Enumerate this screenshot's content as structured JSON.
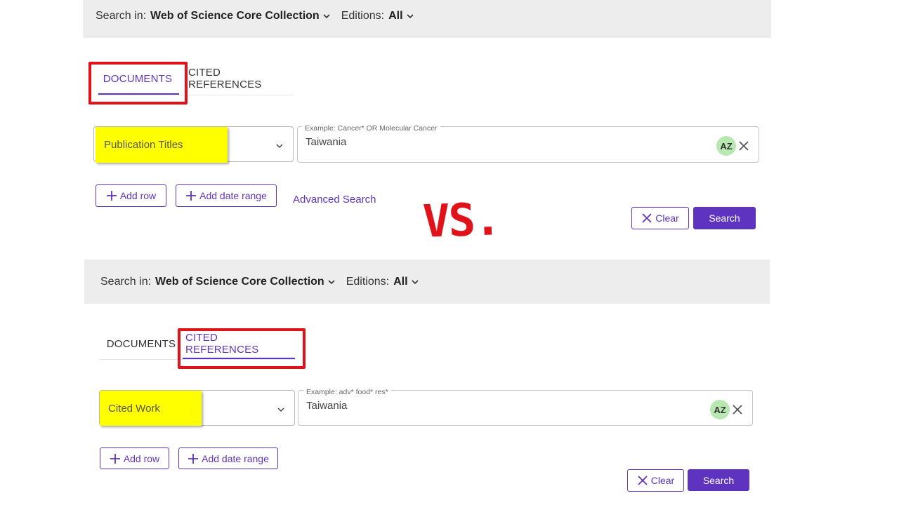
{
  "panel_top": {
    "search_in": {
      "label": "Search in:",
      "value": "Web of Science Core Collection"
    },
    "editions": {
      "label": "Editions:",
      "value": "All"
    },
    "tabs": [
      {
        "label": "DOCUMENTS",
        "active": true
      },
      {
        "label": "CITED REFERENCES",
        "active": false
      }
    ],
    "field_select": {
      "value": "Publication Titles"
    },
    "query": {
      "placeholder": "Example: Cancer* OR Molecular Cancer",
      "value": "Taiwania",
      "az_label": "AZ"
    },
    "add_row_label": "Add row",
    "add_date_range_label": "Add date range",
    "advanced_search_label": "Advanced Search",
    "clear_label": "Clear",
    "search_label": "Search"
  },
  "separator_text": "VS.",
  "panel_bottom": {
    "search_in": {
      "label": "Search in:",
      "value": "Web of Science Core Collection"
    },
    "editions": {
      "label": "Editions:",
      "value": "All"
    },
    "tabs": [
      {
        "label": "DOCUMENTS",
        "active": false
      },
      {
        "label": "CITED REFERENCES",
        "active": true
      }
    ],
    "field_select": {
      "value": "Cited Work"
    },
    "query": {
      "placeholder": "Example: adv* food* res*",
      "value": "Taiwania",
      "az_label": "AZ"
    },
    "add_row_label": "Add row",
    "add_date_range_label": "Add date range",
    "clear_label": "Clear",
    "search_label": "Search"
  },
  "colors": {
    "accent": "#5e33bf",
    "highlight": "#ffff00",
    "annotation_red": "#e0131b",
    "bar_bg": "#ededed"
  }
}
